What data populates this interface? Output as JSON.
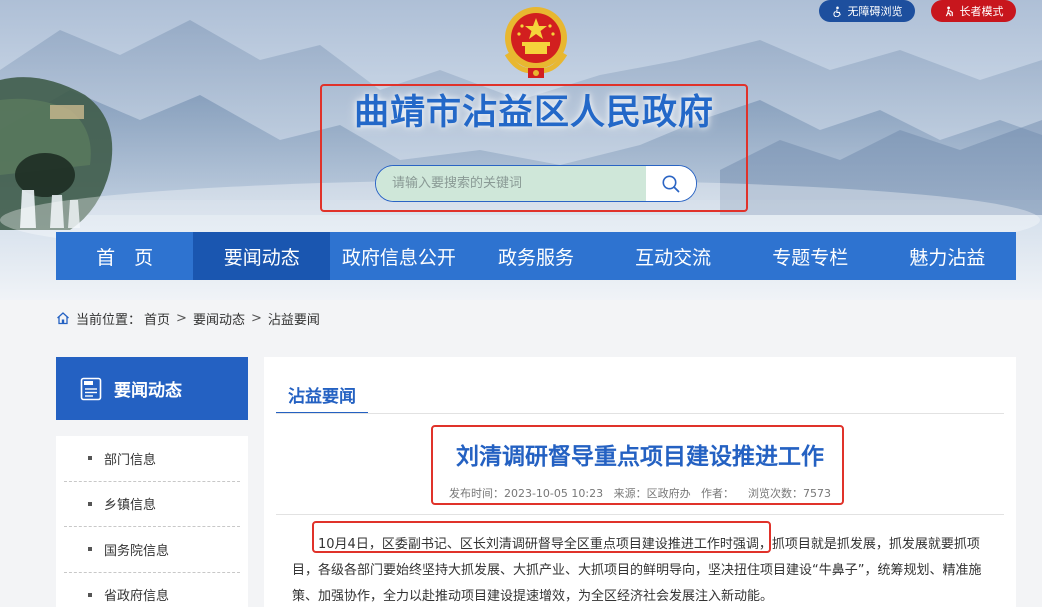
{
  "accessibility": {
    "barrier_free_label": "无障碍浏览",
    "elder_mode_label": "长者模式"
  },
  "site": {
    "title": "曲靖市沾益区人民政府"
  },
  "search": {
    "placeholder": "请输入要搜索的关键词"
  },
  "nav": {
    "items": [
      "首　页",
      "要闻动态",
      "政府信息公开",
      "政务服务",
      "互动交流",
      "专题专栏",
      "魅力沾益"
    ],
    "active_index": 1
  },
  "breadcrumb": {
    "prefix": "当前位置：",
    "crumbs": [
      "首页",
      "要闻动态",
      "沾益要闻"
    ],
    "separator": ">"
  },
  "sidebar": {
    "heading": "要闻动态",
    "items": [
      "部门信息",
      "乡镇信息",
      "国务院信息",
      "省政府信息"
    ]
  },
  "content": {
    "tab_label": "沾益要闻",
    "article_title": "刘清调研督导重点项目建设推进工作",
    "meta": "发布时间：2023-10-05 10:23   来源：区政府办   作者：    浏览次数：7573",
    "body": "10月4日，区委副书记、区长刘清调研督导全区重点项目建设推进工作时强调，抓项目就是抓发展，抓发展就要抓项目，各级各部门要始终坚持大抓发展、大抓产业、大抓项目的鲜明导向，坚决扭住项目建设“牛鼻子”，统筹规划、精准施策、加强协作，全力以赴推动项目建设提速增效，为全区经济社会发展注入新动能。"
  },
  "colors": {
    "nav_bg": "#2e73d0",
    "nav_active": "#1a56b0",
    "brand_blue": "#2461c2",
    "elder_red": "#c8161d",
    "highlight_red": "#e0322a"
  }
}
